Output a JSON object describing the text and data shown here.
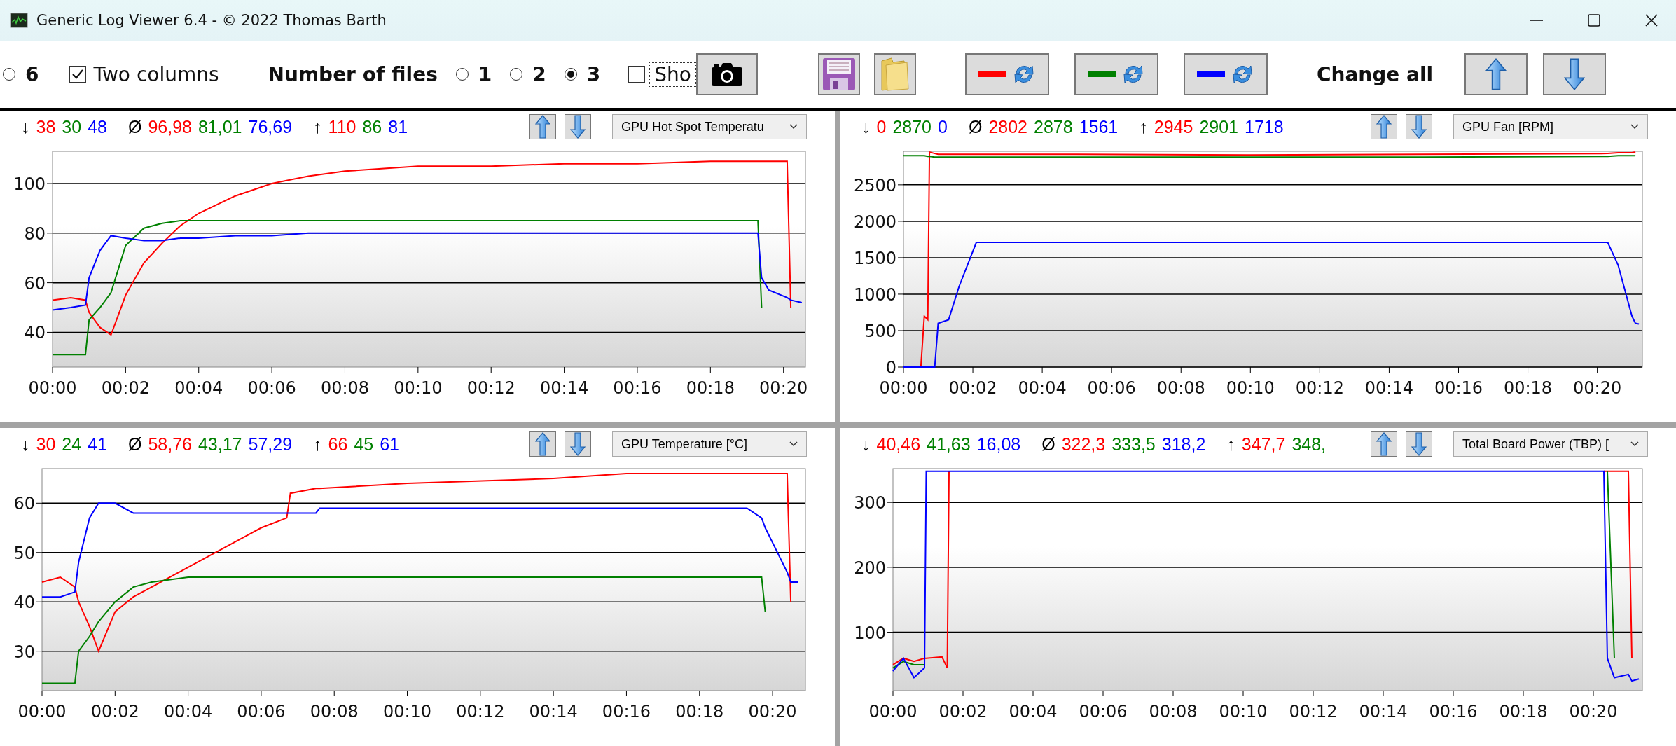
{
  "window": {
    "title": "Generic Log Viewer 6.4 - © 2022 Thomas Barth"
  },
  "toolbar": {
    "layout_radio": {
      "label": "6",
      "selected": false
    },
    "two_columns": {
      "label": "Two columns",
      "checked": true
    },
    "files_label": "Number of files",
    "file_count": [
      {
        "label": "1",
        "selected": false
      },
      {
        "label": "2",
        "selected": false
      },
      {
        "label": "3",
        "selected": true
      }
    ],
    "show": {
      "label": "Sho",
      "checked": false
    },
    "file_colors": [
      {
        "color": "#ff0000"
      },
      {
        "color": "#008000"
      },
      {
        "color": "#0000ff"
      }
    ],
    "change_all_label": "Change all"
  },
  "panels": [
    {
      "stats": [
        {
          "symbol": "↓",
          "values": [
            "38",
            "30",
            "48"
          ]
        },
        {
          "symbol": "Ø",
          "values": [
            "96,98",
            "81,01",
            "76,69"
          ]
        },
        {
          "symbol": "↑",
          "values": [
            "110",
            "86",
            "81"
          ]
        }
      ],
      "metric": "GPU Hot Spot Temperatu",
      "chart_data": {
        "type": "line",
        "x": [
          0,
          0.5,
          0.9,
          1.0,
          1.3,
          1.6,
          2,
          2.5,
          3,
          3.5,
          4,
          5,
          6,
          7,
          8,
          9,
          10,
          12,
          14,
          16,
          18,
          19.3,
          19.4,
          19.6,
          20.1,
          20.2,
          20.5
        ],
        "series": [
          {
            "color": "#ff0000",
            "values": [
              53,
              54,
              53,
              48,
              42,
              39,
              55,
              68,
              76,
              83,
              88,
              95,
              100,
              103,
              105,
              106,
              107,
              107,
              108,
              108,
              109,
              109,
              109,
              109,
              109,
              50,
              null
            ]
          },
          {
            "color": "#008000",
            "values": [
              31,
              31,
              31,
              45,
              50,
              56,
              75,
              82,
              84,
              85,
              85,
              85,
              85,
              85,
              85,
              85,
              85,
              85,
              85,
              85,
              85,
              85,
              50,
              null,
              null,
              null,
              null
            ]
          },
          {
            "color": "#0000ff",
            "values": [
              49,
              50,
              51,
              62,
              73,
              79,
              78,
              77,
              77,
              78,
              78,
              79,
              79,
              80,
              80,
              80,
              80,
              80,
              80,
              80,
              80,
              80,
              62,
              57,
              54,
              53,
              52
            ]
          }
        ],
        "grid": true,
        "xlim": [
          0,
          20.6
        ],
        "ylim": [
          26,
          113
        ],
        "yticks": [
          40,
          60,
          80,
          100
        ],
        "xticks": [
          {
            "value": 0,
            "label": "00:00"
          },
          {
            "value": 2,
            "label": "00:02"
          },
          {
            "value": 4,
            "label": "00:04"
          },
          {
            "value": 6,
            "label": "00:06"
          },
          {
            "value": 8,
            "label": "00:08"
          },
          {
            "value": 10,
            "label": "00:10"
          },
          {
            "value": 12,
            "label": "00:12"
          },
          {
            "value": 14,
            "label": "00:14"
          },
          {
            "value": 16,
            "label": "00:16"
          },
          {
            "value": 18,
            "label": "00:18"
          },
          {
            "value": 20,
            "label": "00:20"
          }
        ]
      }
    },
    {
      "stats": [
        {
          "symbol": "↓",
          "values": [
            "0",
            "2870",
            "0"
          ]
        },
        {
          "symbol": "Ø",
          "values": [
            "2802",
            "2878",
            "1561"
          ]
        },
        {
          "symbol": "↑",
          "values": [
            "2945",
            "2901",
            "1718"
          ]
        }
      ],
      "metric": "GPU Fan [RPM]",
      "chart_data": {
        "type": "line",
        "x": [
          0,
          0.5,
          0.6,
          0.7,
          0.75,
          0.9,
          1.0,
          1.3,
          1.6,
          2.1,
          5,
          10,
          15,
          20.3,
          20.6,
          21.0,
          21.1,
          21.2
        ],
        "series": [
          {
            "color": "#ff0000",
            "values": [
              0,
              0,
              700,
              650,
              2950,
              2930,
              2920,
              2920,
              2920,
              2920,
              2920,
              2910,
              2920,
              2930,
              2940,
              2940,
              2950,
              null
            ]
          },
          {
            "color": "#008000",
            "values": [
              2900,
              2900,
              2900,
              2890,
              2890,
              2880,
              2880,
              2880,
              2880,
              2880,
              2880,
              2880,
              2880,
              2890,
              2900,
              2900,
              2900,
              null
            ]
          },
          {
            "color": "#0000ff",
            "values": [
              0,
              0,
              0,
              0,
              0,
              0,
              600,
              650,
              1100,
              1710,
              1710,
              1710,
              1710,
              1710,
              1400,
              700,
              600,
              590
            ]
          }
        ],
        "grid": true,
        "xlim": [
          0,
          21.3
        ],
        "ylim": [
          0,
          2960
        ],
        "yticks": [
          0,
          500,
          1000,
          1500,
          2000,
          2500
        ],
        "xticks": [
          {
            "value": 0,
            "label": "00:00"
          },
          {
            "value": 2,
            "label": "00:02"
          },
          {
            "value": 4,
            "label": "00:04"
          },
          {
            "value": 6,
            "label": "00:06"
          },
          {
            "value": 8,
            "label": "00:08"
          },
          {
            "value": 10,
            "label": "00:10"
          },
          {
            "value": 12,
            "label": "00:12"
          },
          {
            "value": 14,
            "label": "00:14"
          },
          {
            "value": 16,
            "label": "00:16"
          },
          {
            "value": 18,
            "label": "00:18"
          },
          {
            "value": 20,
            "label": "00:20"
          }
        ]
      }
    },
    {
      "stats": [
        {
          "symbol": "↓",
          "values": [
            "30",
            "24",
            "41"
          ]
        },
        {
          "symbol": "Ø",
          "values": [
            "58,76",
            "43,17",
            "57,29"
          ]
        },
        {
          "symbol": "↑",
          "values": [
            "66",
            "45",
            "61"
          ]
        }
      ],
      "metric": "GPU Temperature [°C]",
      "chart_data": {
        "type": "line",
        "x": [
          0,
          0.5,
          0.9,
          1.0,
          1.3,
          1.55,
          2,
          2.5,
          3,
          4,
          5,
          6,
          6.7,
          6.8,
          7.5,
          7.6,
          10,
          14,
          16,
          19.3,
          19.7,
          19.8,
          20.4,
          20.5,
          20.7
        ],
        "series": [
          {
            "color": "#ff0000",
            "values": [
              44,
              45,
              43,
              40,
              35,
              30,
              38,
              41,
              43,
              47,
              51,
              55,
              57,
              62,
              63,
              63,
              64,
              65,
              66,
              66,
              66,
              66,
              66,
              40,
              null
            ]
          },
          {
            "color": "#008000",
            "values": [
              23.5,
              23.5,
              23.5,
              30,
              33,
              36,
              40,
              43,
              44,
              45,
              45,
              45,
              45,
              45,
              45,
              45,
              45,
              45,
              45,
              45,
              45,
              38,
              null,
              null,
              null
            ]
          },
          {
            "color": "#0000ff",
            "values": [
              41,
              41,
              42,
              48,
              57,
              60,
              60,
              58,
              58,
              58,
              58,
              58,
              58,
              58,
              58,
              59,
              59,
              59,
              59,
              59,
              57,
              55,
              46,
              44,
              44
            ]
          }
        ],
        "grid": true,
        "xlim": [
          0,
          20.9
        ],
        "ylim": [
          22,
          67
        ],
        "yticks": [
          30,
          40,
          50,
          60
        ],
        "xticks": [
          {
            "value": 0,
            "label": "00:00"
          },
          {
            "value": 2,
            "label": "00:02"
          },
          {
            "value": 4,
            "label": "00:04"
          },
          {
            "value": 6,
            "label": "00:06"
          },
          {
            "value": 8,
            "label": "00:08"
          },
          {
            "value": 10,
            "label": "00:10"
          },
          {
            "value": 12,
            "label": "00:12"
          },
          {
            "value": 14,
            "label": "00:14"
          },
          {
            "value": 16,
            "label": "00:16"
          },
          {
            "value": 18,
            "label": "00:18"
          },
          {
            "value": 20,
            "label": "00:20"
          }
        ]
      }
    },
    {
      "stats": [
        {
          "symbol": "↓",
          "values": [
            "40,46",
            "41,63",
            "16,08"
          ]
        },
        {
          "symbol": "Ø",
          "values": [
            "322,3",
            "333,5",
            "318,2"
          ]
        },
        {
          "symbol": "↑",
          "values": [
            "347,7",
            "348,"
          ]
        }
      ],
      "metric": "Total Board Power (TBP) [",
      "chart_data": {
        "type": "line",
        "x": [
          0,
          0.3,
          0.6,
          0.9,
          0.95,
          1.4,
          1.55,
          1.6,
          5,
          10,
          15,
          20.3,
          20.4,
          20.6,
          21.0,
          21.1,
          21.3
        ],
        "series": [
          {
            "color": "#ff0000",
            "values": [
              50,
              60,
              55,
              60,
              60,
              62,
              45,
              348,
              null,
              null,
              null,
              348,
              348,
              348,
              348,
              60,
              null
            ]
          },
          {
            "color": "#008000",
            "values": [
              45,
              55,
              50,
              50,
              null,
              null,
              null,
              null,
              null,
              null,
              null,
              null,
              348,
              60,
              null,
              null,
              null
            ]
          },
          {
            "color": "#0000ff",
            "values": [
              40,
              60,
              30,
              45,
              348,
              348,
              348,
              348,
              348,
              348,
              348,
              348,
              60,
              30,
              35,
              25,
              28
            ]
          }
        ],
        "grid": true,
        "xlim": [
          0,
          21.4
        ],
        "ylim": [
          10,
          352
        ],
        "yticks": [
          100,
          200,
          300
        ],
        "xticks": [
          {
            "value": 0,
            "label": "00:00"
          },
          {
            "value": 2,
            "label": "00:02"
          },
          {
            "value": 4,
            "label": "00:04"
          },
          {
            "value": 6,
            "label": "00:06"
          },
          {
            "value": 8,
            "label": "00:08"
          },
          {
            "value": 10,
            "label": "00:10"
          },
          {
            "value": 12,
            "label": "00:12"
          },
          {
            "value": 14,
            "label": "00:14"
          },
          {
            "value": 16,
            "label": "00:16"
          },
          {
            "value": 18,
            "label": "00:18"
          },
          {
            "value": 20,
            "label": "00:20"
          }
        ]
      }
    }
  ]
}
